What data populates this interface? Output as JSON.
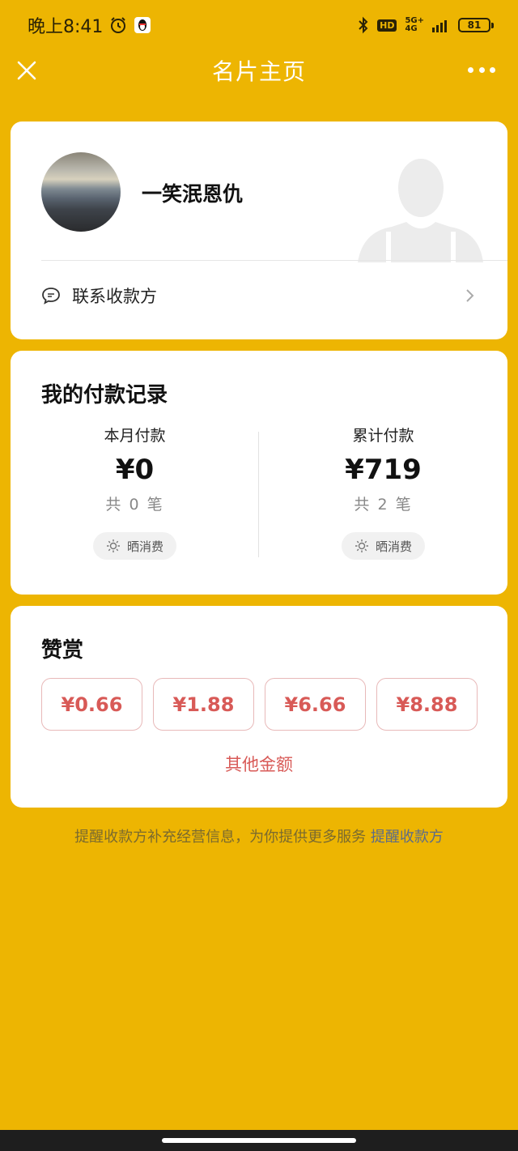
{
  "status_bar": {
    "time": "晚上8:41",
    "network": "5G+",
    "network_sub": "4G",
    "hd": "HD",
    "battery": "81"
  },
  "nav": {
    "title": "名片主页"
  },
  "profile": {
    "name": "一笑泯恩仇",
    "contact_label": "联系收款方"
  },
  "records": {
    "title": "我的付款记录",
    "month": {
      "label": "本月付款",
      "amount": "¥0",
      "count": "共 0 笔",
      "share": "晒消费"
    },
    "total": {
      "label": "累计付款",
      "amount": "¥719",
      "count": "共 2 笔",
      "share": "晒消费"
    }
  },
  "tip": {
    "title": "赞赏",
    "amounts": [
      "¥0.66",
      "¥1.88",
      "¥6.66",
      "¥8.88"
    ],
    "other": "其他金额"
  },
  "footer": {
    "note": "提醒收款方补充经营信息，为你提供更多服务",
    "link": "提醒收款方"
  },
  "colors": {
    "background": "#EDB502",
    "accent_red": "#D85A57",
    "link_blue": "#5B6B8A"
  }
}
